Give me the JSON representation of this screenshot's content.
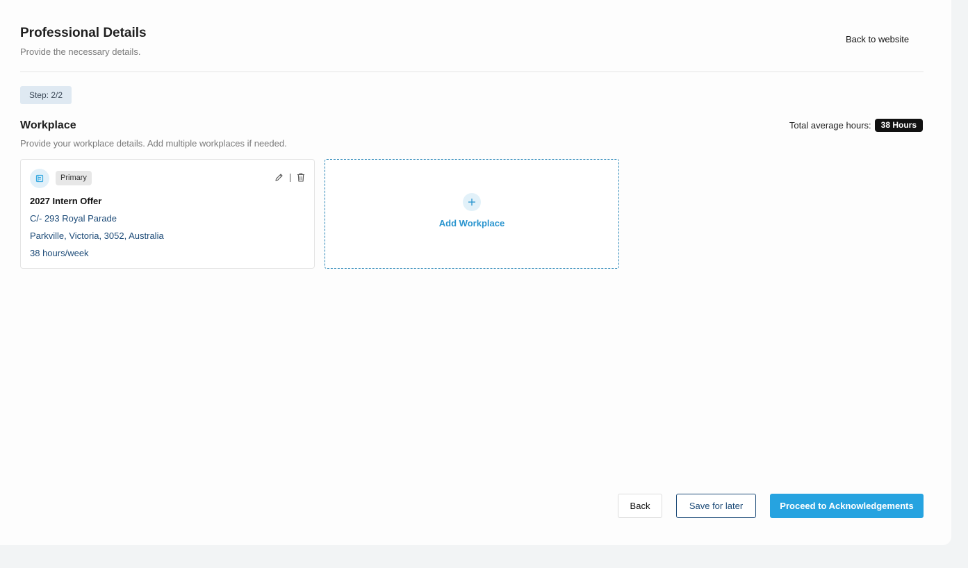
{
  "header": {
    "title": "Professional Details",
    "subtitle": "Provide the necessary details.",
    "back_to_website": "Back to website"
  },
  "step": {
    "label": "Step: 2/2"
  },
  "workplace_section": {
    "title": "Workplace",
    "description": "Provide your workplace details. Add multiple workplaces if needed.",
    "total_hours_label": "Total average hours:",
    "total_hours_value": "38 Hours"
  },
  "workplaces": [
    {
      "tag": "Primary",
      "name": "2027 Intern Offer",
      "address_line1": "C/- 293 Royal Parade",
      "address_line2": "Parkville, Victoria, 3052, Australia",
      "hours": "38 hours/week",
      "icons": [
        "building-icon",
        "edit-icon",
        "delete-icon"
      ]
    }
  ],
  "add_workplace": {
    "label": "Add Workplace",
    "icon": "plus-icon"
  },
  "footer": {
    "back_label": "Back",
    "save_label": "Save for later",
    "proceed_label": "Proceed to Acknowledgements"
  },
  "colors": {
    "accent": "#26a3e0",
    "link_text": "#1d4b78",
    "page_bg": "#f2f4f5",
    "panel_bg": "#fdfdfd"
  }
}
